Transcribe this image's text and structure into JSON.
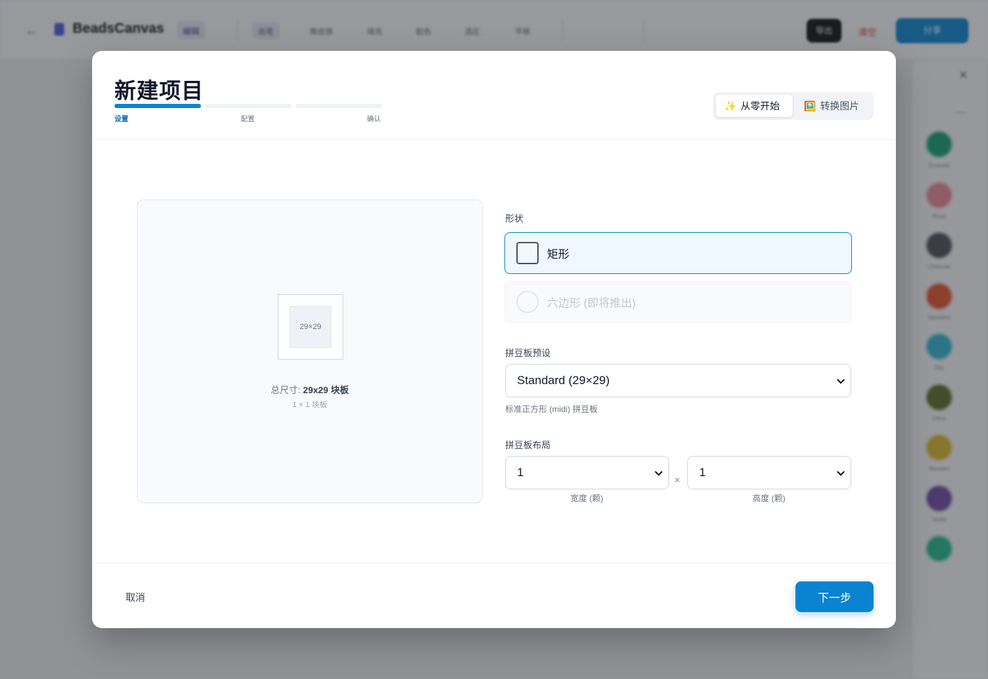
{
  "background": {
    "app_name": "BeadsCanvas",
    "chip_label": "编辑",
    "tools": [
      "画笔",
      "橡皮擦",
      "填充",
      "取色",
      "选区",
      "平移"
    ],
    "dark_button": "导出",
    "red_text": "清空",
    "primary_button": "分享",
    "palette_labels": [
      "Emerald",
      "Rose",
      "Charcoal",
      "Vermilion",
      "Sky",
      "Olive",
      "Mustard",
      "Violet",
      "Teal"
    ],
    "palette_colors": [
      "#14a06a",
      "#e78a93",
      "#4b4f55",
      "#e0522f",
      "#31b4cf",
      "#5d6b22",
      "#d9b72b",
      "#6b4aa0",
      "#27b88e"
    ]
  },
  "modal": {
    "title": "新建项目",
    "steps": [
      {
        "label": "设置",
        "active": true
      },
      {
        "label": "配置",
        "active": false
      },
      {
        "label": "确认",
        "active": false
      }
    ],
    "modes": [
      {
        "icon": "✨",
        "label": "从零开始",
        "active": true
      },
      {
        "icon": "🖼️",
        "label": "转换图片",
        "active": false
      }
    ],
    "preview": {
      "board_text": "29×29",
      "total_label": "总尺寸: ",
      "total_value": "29x29 块板",
      "layout_text": "1 × 1 块板"
    },
    "shape": {
      "label": "形状",
      "options": [
        {
          "name": "矩形",
          "selected": true,
          "disabled": false
        },
        {
          "name": "六边形 (即将推出)",
          "selected": false,
          "disabled": true
        }
      ]
    },
    "preset": {
      "label": "拼豆板预设",
      "value": "Standard (29×29)",
      "help": "标准正方形 (midi) 拼豆板"
    },
    "layout": {
      "label": "拼豆板布局",
      "width_value": "1",
      "height_value": "1",
      "times": "×",
      "width_label": "宽度 (颗)",
      "height_label": "高度 (颗)"
    },
    "footer": {
      "cancel": "取消",
      "next": "下一步"
    }
  },
  "colors": {
    "accent": "#0a84d0",
    "selected_bg": "#eff8fe"
  }
}
